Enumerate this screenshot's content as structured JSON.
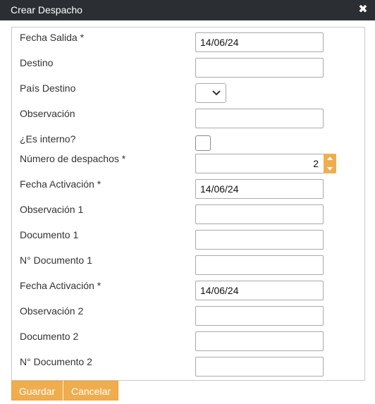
{
  "dialog": {
    "title": "Crear Despacho",
    "close_icon": "close-icon"
  },
  "form": {
    "fecha_salida": {
      "label": "Fecha Salida *",
      "value": "14/06/24"
    },
    "destino": {
      "label": "Destino",
      "value": ""
    },
    "pais_destino": {
      "label": "País Destino",
      "selected": ""
    },
    "observacion": {
      "label": "Observación",
      "value": ""
    },
    "es_interno": {
      "label": "¿Es interno?",
      "checked": false
    },
    "numero_despachos": {
      "label": "Número de despachos *",
      "value": "2"
    },
    "fecha_activacion_1": {
      "label": "Fecha Activación *",
      "value": "14/06/24"
    },
    "observacion_1": {
      "label": "Observación 1",
      "value": ""
    },
    "documento_1": {
      "label": "Documento 1",
      "value": ""
    },
    "n_documento_1": {
      "label": "N° Documento 1",
      "value": ""
    },
    "fecha_activacion_2": {
      "label": "Fecha Activación *",
      "value": "14/06/24"
    },
    "observacion_2": {
      "label": "Observación 2",
      "value": ""
    },
    "documento_2": {
      "label": "Documento 2",
      "value": ""
    },
    "n_documento_2": {
      "label": "N° Documento 2",
      "value": ""
    }
  },
  "footer": {
    "save_label": "Guardar",
    "cancel_label": "Cancelar"
  },
  "colors": {
    "titlebar": "#2b2f33",
    "accent": "#f0ad4e",
    "border": "#c9c9c9"
  }
}
